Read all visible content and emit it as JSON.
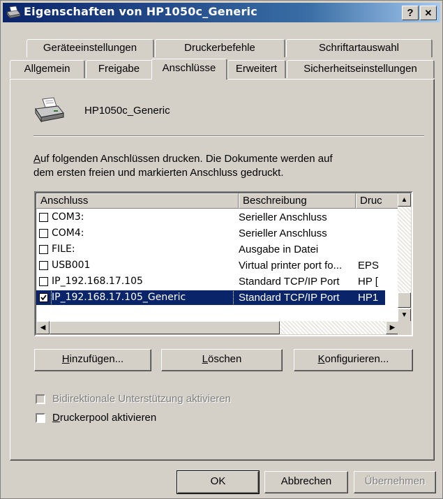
{
  "window": {
    "title": "Eigenschaften von HP1050c_Generic",
    "help_label": "?",
    "close_label": "✕"
  },
  "tabs_row1": [
    "Geräteeinstellungen",
    "Druckerbefehle",
    "Schriftartauswahl"
  ],
  "tabs_row2": [
    "Allgemein",
    "Freigabe",
    "Anschlüsse",
    "Erweitert",
    "Sicherheitseinstellungen"
  ],
  "active_tab": "Anschlüsse",
  "printer": {
    "name": "HP1050c_Generic",
    "icon": "printer-icon"
  },
  "description": {
    "line1": "Auf folgenden Anschlüssen drucken. Die Dokumente werden auf",
    "line2": "dem ersten freien und markierten Anschluss gedruckt.",
    "accel": "A"
  },
  "ports": {
    "columns": [
      "Anschluss",
      "Beschreibung",
      "Druc"
    ],
    "rows": [
      {
        "port": "COM3:",
        "description": "Serieller Anschluss",
        "printer": "",
        "checked": false,
        "selected": false
      },
      {
        "port": "COM4:",
        "description": "Serieller Anschluss",
        "printer": "",
        "checked": false,
        "selected": false
      },
      {
        "port": "FILE:",
        "description": "Ausgabe in Datei",
        "printer": "",
        "checked": false,
        "selected": false
      },
      {
        "port": "USB001",
        "description": "Virtual printer port fo...",
        "printer": "EPS",
        "checked": false,
        "selected": false
      },
      {
        "port": "IP_192.168.17.105",
        "description": "Standard TCP/IP Port",
        "printer": "HP [",
        "checked": false,
        "selected": false
      },
      {
        "port": "IP_192.168.17.105_Generic",
        "description": "Standard TCP/IP Port",
        "printer": "HP1",
        "checked": true,
        "selected": true
      }
    ]
  },
  "port_buttons": {
    "add": "Hinzufügen...",
    "delete": "Löschen",
    "configure": "Konfigurieren..."
  },
  "options": {
    "bidirectional": {
      "label": "Bidirektionale Unterstützung aktivieren",
      "checked": false,
      "enabled": false
    },
    "pool": {
      "label": "Druckerpool aktivieren",
      "checked": false,
      "enabled": true
    }
  },
  "dialog_buttons": {
    "ok": "OK",
    "cancel": "Abbrechen",
    "apply": "Übernehmen"
  },
  "colors": {
    "title_start": "#0a246a",
    "title_end": "#a6caf0",
    "selection": "#0a246a",
    "face": "#d4d0c8"
  }
}
